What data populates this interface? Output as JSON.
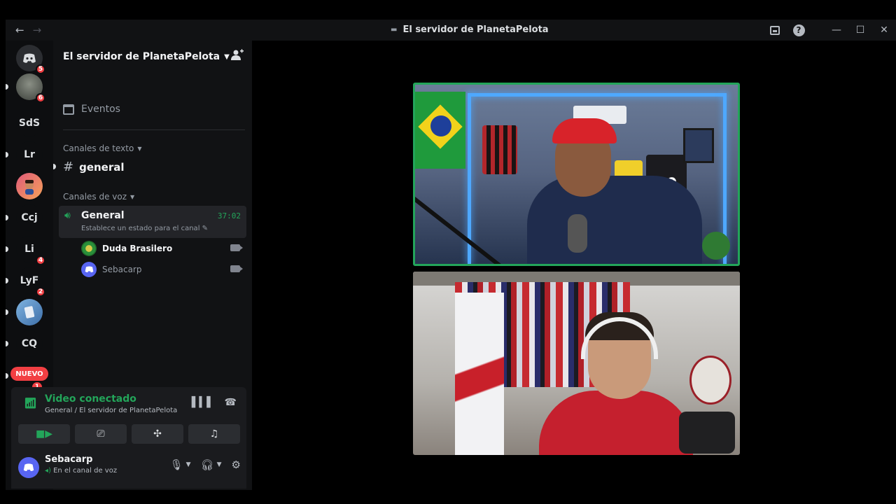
{
  "titlebar": {
    "title": "El servidor de PlanetaPelota",
    "back": "←",
    "forward": "→"
  },
  "rail": {
    "servers": [
      {
        "label": "",
        "badge": "5"
      },
      {
        "label": "",
        "badge": "6"
      },
      {
        "label": "SdS",
        "badge": ""
      },
      {
        "label": "Lr",
        "badge": ""
      },
      {
        "label": "",
        "badge": ""
      },
      {
        "label": "Ccj",
        "badge": ""
      },
      {
        "label": "Li",
        "badge": "4"
      },
      {
        "label": "LyF",
        "badge": "2"
      },
      {
        "label": "",
        "badge": ""
      },
      {
        "label": "CQ",
        "badge": ""
      }
    ],
    "nuevo": "NUEVO",
    "nuevo_badge": "1"
  },
  "guild": {
    "name": "El servidor de PlanetaPelota",
    "events": "Eventos",
    "text_category": "Canales de texto",
    "text_channel": "general",
    "voice_category": "Canales de voz",
    "voice_channel": {
      "name": "General",
      "timer": "37:02",
      "status": "Establece un estado para el canal"
    },
    "members": [
      {
        "name": "Duda Brasilero"
      },
      {
        "name": "Sebacarp"
      }
    ]
  },
  "rtc": {
    "status": "Video conectado",
    "location": "General / El servidor de PlanetaPelota"
  },
  "user": {
    "name": "Sebacarp",
    "status": "En el canal de voz"
  },
  "colors": {
    "accent_green": "#23a55a",
    "danger_red": "#f23f43",
    "blurple": "#5865f2",
    "speaking_border": "#23a55a"
  },
  "icons": [
    "discord-home-icon",
    "calendar-icon",
    "hash-icon",
    "speaker-icon",
    "camera-icon",
    "signal-icon",
    "waveform-icon",
    "hangup-icon",
    "screen-share-icon",
    "activities-icon",
    "soundboard-icon",
    "microphone-icon",
    "headphones-icon",
    "gear-icon",
    "add-member-icon",
    "inbox-icon",
    "help-icon"
  ]
}
